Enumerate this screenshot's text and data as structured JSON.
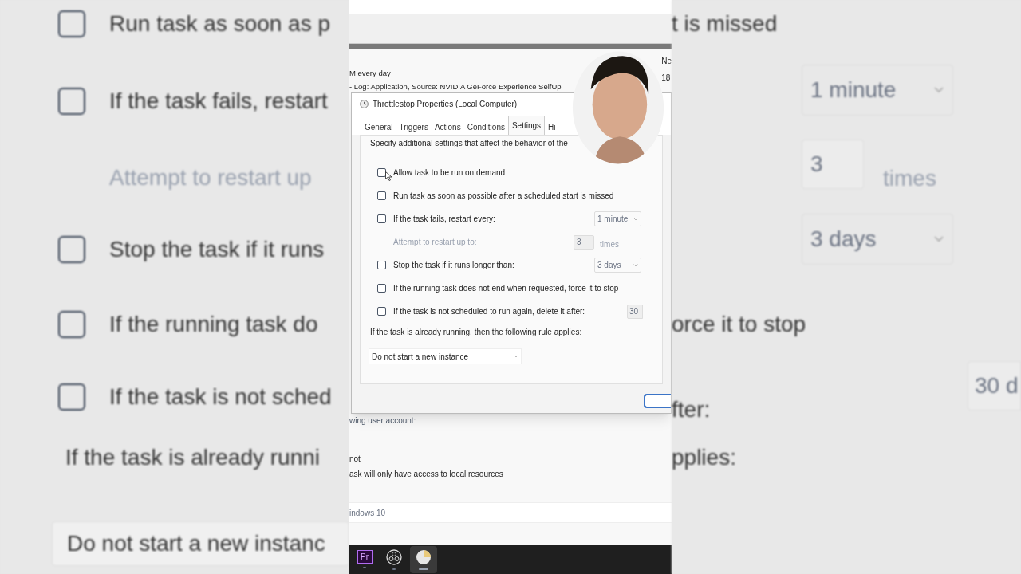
{
  "backdrop_left": [
    {
      "kind": "checkbox",
      "text": "Run task as soon as p",
      "checked": false
    },
    {
      "kind": "checkbox",
      "text": "If the task fails, restart",
      "checked": false
    },
    {
      "kind": "label",
      "text": "Attempt to restart up",
      "disabled": true
    },
    {
      "kind": "checkbox",
      "text": "Stop the task if it runs",
      "checked": false
    },
    {
      "kind": "checkbox",
      "text": "If the running task do",
      "checked": false
    },
    {
      "kind": "checkbox",
      "text": "If the task is not sched",
      "checked": false
    },
    {
      "kind": "label",
      "text": "If the task is already runni",
      "disabled": false
    },
    {
      "kind": "dropdown",
      "text": "Do not start a new instanc"
    }
  ],
  "backdrop_right": [
    {
      "kind": "text",
      "text": "t is missed"
    },
    {
      "kind": "dropdown",
      "text": "1 minute"
    },
    {
      "kind": "spin",
      "text": "3",
      "unit": "times"
    },
    {
      "kind": "dropdown",
      "text": "3 days"
    },
    {
      "kind": "text",
      "text": "orce it to stop"
    },
    {
      "kind": "text_field",
      "text": "fter:",
      "field": "30 d"
    },
    {
      "kind": "text",
      "text": "pplies:"
    }
  ],
  "back_window": {
    "lines": [
      "M every day",
      "- Log: Application, Source: NVIDIA GeForce Experience SelfUp"
    ],
    "column_header": "Ne",
    "column_value": "18",
    "below": [
      "wing user account:",
      "not",
      "ask will only have access to local resources"
    ],
    "os_field": "indows 10"
  },
  "dialog": {
    "title": "Throttlestop Properties (Local Computer)",
    "tabs": [
      {
        "label": "General",
        "selected": false
      },
      {
        "label": "Triggers",
        "selected": false
      },
      {
        "label": "Actions",
        "selected": false
      },
      {
        "label": "Conditions",
        "selected": false
      },
      {
        "label": "Settings",
        "selected": true
      },
      {
        "label": "Hi",
        "selected": false
      }
    ],
    "intro": "Specify additional settings that affect the behavior of the",
    "options": [
      {
        "kind": "checkbox",
        "label": "Allow task to be run on demand",
        "checked": false
      },
      {
        "kind": "checkbox",
        "label": "Run task as soon as possible after a scheduled start is missed",
        "checked": false
      },
      {
        "kind": "checkbox",
        "label": "If the task fails, restart every:",
        "checked": false,
        "dropdown": "1 minute"
      },
      {
        "kind": "indent",
        "label": "Attempt to restart up to:",
        "disabled": true,
        "spin": "3",
        "unit": "times"
      },
      {
        "kind": "checkbox",
        "label": "Stop the task if it runs longer than:",
        "checked": false,
        "dropdown": "3 days"
      },
      {
        "kind": "checkbox",
        "label": "If the running task does not end when requested, force it to stop",
        "checked": false
      },
      {
        "kind": "checkbox",
        "label": "If the task is not scheduled to run again, delete it after:",
        "checked": false,
        "field": "30"
      }
    ],
    "rule_label": "If the task is already running, then the following rule applies:",
    "rule_value": "Do not start a new instance"
  },
  "taskbar": [
    {
      "kind": "premiere",
      "label": "Pr",
      "selected": false
    },
    {
      "kind": "obs",
      "selected": false
    },
    {
      "kind": "clock",
      "selected": true
    }
  ]
}
